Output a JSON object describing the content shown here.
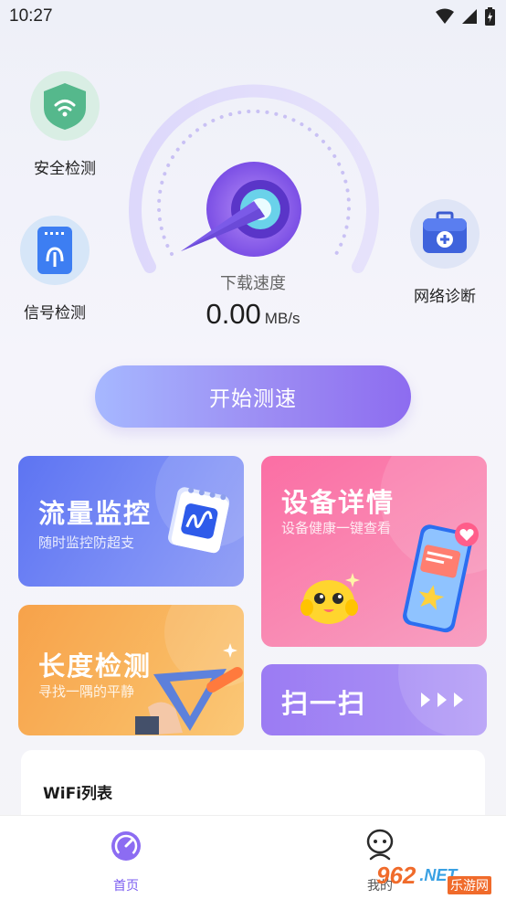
{
  "status_bar": {
    "time": "10:27"
  },
  "speed": {
    "label": "下载速度",
    "value": "0.00",
    "unit": "MB/s"
  },
  "quick_actions": {
    "security": "安全检测",
    "signal": "信号检测",
    "diagnosis": "网络诊断"
  },
  "start_button": "开始测速",
  "cards": {
    "traffic": {
      "title": "流量监控",
      "subtitle": "随时监控防超支"
    },
    "device": {
      "title": "设备详情",
      "subtitle": "设备健康一键查看"
    },
    "length": {
      "title": "长度检测",
      "subtitle": "寻找一隅的平静"
    },
    "scan": {
      "title": "扫一扫"
    }
  },
  "wifi_list": {
    "title": "WiFi列表"
  },
  "tabbar": {
    "home": "首页",
    "mine": "我的"
  },
  "watermark": {
    "num": "962",
    "dot": ".NET",
    "cn": "乐游网"
  },
  "colors": {
    "accent": "#8d6cf0",
    "tab_active": "#7b5cf0"
  }
}
